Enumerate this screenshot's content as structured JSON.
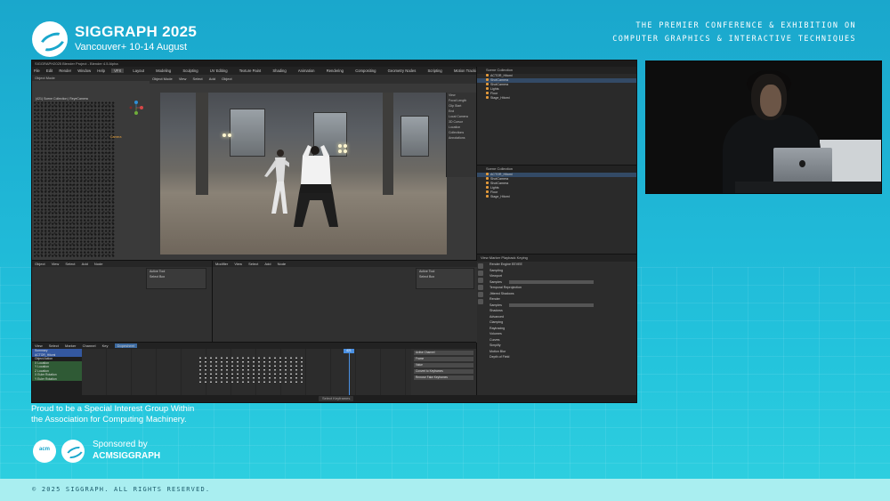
{
  "header": {
    "brand_title": "SIGGRAPH 2025",
    "brand_subtitle": "Vancouver+ 10-14 August",
    "tagline_line1": "THE PREMIER CONFERENCE & EXHIBITION ON",
    "tagline_line2": "COMPUTER GRAPHICS & INTERACTIVE TECHNIQUES"
  },
  "blender": {
    "title": "SIGGRAPH2025 Blender Project - Blender 4.5 Alpha",
    "menus": [
      "File",
      "Edit",
      "Render",
      "Window",
      "Help"
    ],
    "workspaces": [
      "VFX",
      "Layout",
      "Modeling",
      "Sculpting",
      "UV Editing",
      "Texture Paint",
      "Shading",
      "Animation",
      "Rendering",
      "Compositing",
      "Geometry Nodes",
      "Scripting",
      "Motion Tracking",
      "Video Editing"
    ],
    "active_workspace": "VFX",
    "left_view_mode": "Object Mode",
    "left_view_label": "(421) Scene Collection | ReyeCamera",
    "camera_label": "Camera",
    "main_view_menus": [
      "Object Mode",
      "View",
      "Select",
      "Add",
      "Object"
    ],
    "n_panel_items": [
      "View",
      "Focal Length",
      "Clip Start",
      "End",
      "Local Camera",
      "3D Cursor",
      "Location",
      "Collections",
      "Annotations"
    ],
    "outliner1_header": "Scene Collection",
    "outliner1_rows": [
      "ACTOR_Hitomi",
      "ShotCamera",
      "ShotCamera",
      "Lights",
      "Floor",
      "Stage_Hitomi"
    ],
    "outliner2_header": "Scene Collection",
    "outliner2_rows": [
      "ACTOR_Hitomi",
      "ShotCamera",
      "ShotCamera",
      "Lights",
      "Floor",
      "Stage_Hitomi"
    ],
    "props_tabs": [
      "View",
      "Marker",
      "Playback",
      "Keying"
    ],
    "props_rows": [
      "Render Engine  EEVEE",
      "Sampling",
      "Viewport",
      "Samples",
      "Temporal Reprojection",
      "Jittered Shadows",
      "Render",
      "Samples",
      "Shadows",
      "Advanced",
      "Clamping",
      "Raytracing",
      "Volumes",
      "Curves",
      "Simplify",
      "Motion Blur",
      "Depth of Field"
    ],
    "mid_left_menus": [
      "Object",
      "View",
      "Select",
      "Add",
      "Node"
    ],
    "mid_right_menus": [
      "Modifier",
      "View",
      "Select",
      "Add",
      "Node"
    ],
    "tool_box_items": [
      "Active Tool",
      "Select Box"
    ],
    "timeline_menus": [
      "View",
      "Select",
      "Marker",
      "Channel",
      "Key",
      "Dopesheet"
    ],
    "timeline_active": "Dopesheet",
    "timeline_tracks": [
      "Summary",
      "ACTOR_Hitomi",
      "Object Action",
      "X Location",
      "Y Location",
      "Z Location",
      "X Euler Rotation",
      "Y Euler Rotation"
    ],
    "playhead_frame": "421",
    "timeline_side": [
      "Active Channel",
      "Frame",
      "Value",
      "Convert to Keyframes",
      "Remove Fake Keyframes"
    ],
    "status_center": "Select Keyframes"
  },
  "footer": {
    "proud_line1": "Proud to be a Special Interest Group Within",
    "proud_line2": "the Association for Computing Machinery.",
    "acm_logo_text": "acm",
    "sponsored": "Sponsored by",
    "acm_siggraph": "ACMSIGGRAPH",
    "copyright": "© 2025 SIGGRAPH. ALL RIGHTS RESERVED."
  },
  "colors": {
    "background": "#1fb6d6",
    "blender_bg": "#2b2b2b",
    "accent_blue": "#4a90e2",
    "object_orange": "#e59b3b"
  }
}
